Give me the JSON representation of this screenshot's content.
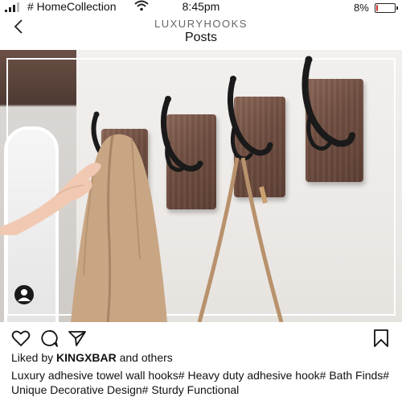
{
  "status_bar": {
    "carrier": "# HomeCollection",
    "time": "8:45pm",
    "battery_percent_label": "8%",
    "battery_level": 0.08
  },
  "header": {
    "account": "LUXURYHOOKS",
    "title": "Posts"
  },
  "post": {
    "liked_by_prefix": "Liked by",
    "liked_by_user": "KINGXBAR",
    "liked_by_suffix": "and others",
    "caption": "Luxury adhesive towel wall hooks# Heavy duty adhesive hook# Bath Finds# Unique Decorative Design# Sturdy  Functional"
  },
  "icons": {
    "back": "chevron-left-icon",
    "like": "heart-icon",
    "comment": "comment-icon",
    "share": "send-icon",
    "save": "bookmark-icon",
    "user_tag": "person-icon"
  },
  "colors": {
    "wood": "#6e4d40",
    "hook": "#1a1a1a",
    "coat": "#c8a684",
    "battery": "#d33333"
  }
}
